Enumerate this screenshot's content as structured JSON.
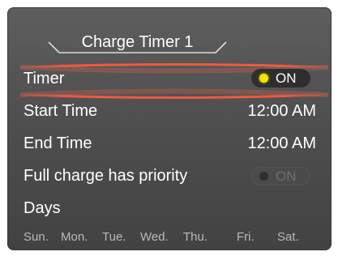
{
  "header": {
    "title": "Charge Timer 1"
  },
  "timer": {
    "label": "Timer",
    "toggle_label": "ON",
    "state": "on"
  },
  "start_time": {
    "label": "Start Time",
    "value": "12:00 AM"
  },
  "end_time": {
    "label": "End Time",
    "value": "12:00 AM"
  },
  "full_charge": {
    "label": "Full charge has priority",
    "toggle_label": "ON",
    "state": "off"
  },
  "days": {
    "label": "Days",
    "items": [
      "Sun.",
      "Mon.",
      "Tue.",
      "Wed.",
      "Thu.",
      "Fri.",
      "Sat."
    ]
  },
  "colors": {
    "highlight": "#ff5a3c",
    "on_indicator": "#f5e300",
    "background": "#4f4f4f",
    "day_text": "#b9b9b9"
  }
}
